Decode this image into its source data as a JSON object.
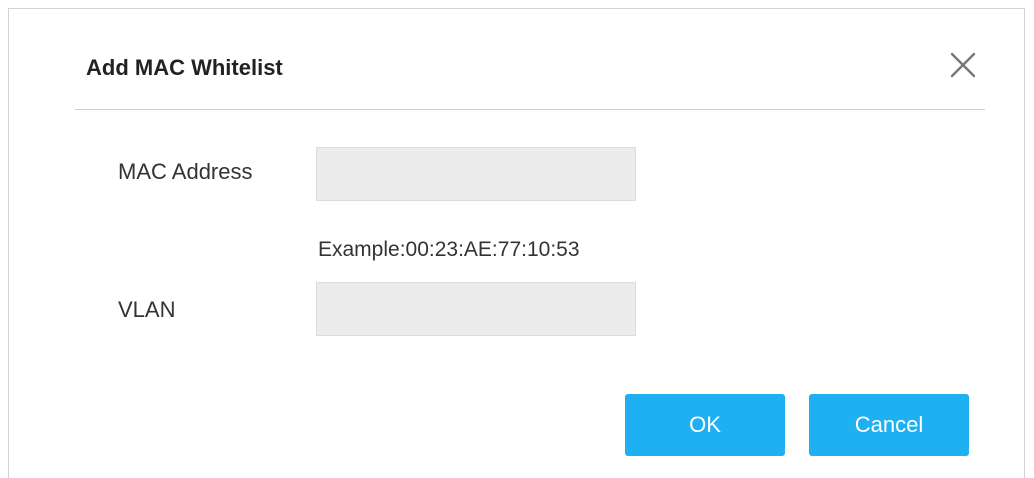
{
  "dialog": {
    "title": "Add MAC Whitelist",
    "close_icon": "close-icon"
  },
  "form": {
    "mac_address": {
      "label": "MAC Address",
      "value": "",
      "hint": "Example:00:23:AE:77:10:53"
    },
    "vlan": {
      "label": "VLAN",
      "value": ""
    }
  },
  "buttons": {
    "ok_label": "OK",
    "cancel_label": "Cancel"
  },
  "colors": {
    "primary_button": "#1fb0f2",
    "input_background": "#ececec",
    "divider": "#cfcfcf"
  }
}
